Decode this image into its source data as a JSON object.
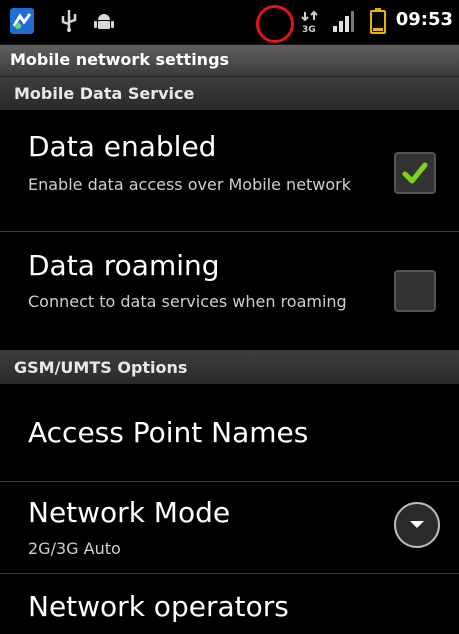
{
  "status_bar": {
    "time": "09:53",
    "network_type": "3G",
    "icons": [
      "sync-icon",
      "usb-icon",
      "android-debug-icon",
      "network-3g-icon",
      "signal-icon",
      "battery-icon"
    ]
  },
  "title_bar": {
    "title": "Mobile network settings"
  },
  "sections": {
    "mobile_data": {
      "label": "Mobile Data Service"
    },
    "gsm": {
      "label": "GSM/UMTS Options"
    }
  },
  "settings": {
    "data_enabled": {
      "title": "Data enabled",
      "summary": "Enable data access over Mobile network",
      "checked": true
    },
    "data_roaming": {
      "title": "Data roaming",
      "summary": "Connect to data services when roaming",
      "checked": false
    },
    "apn": {
      "title": "Access Point Names"
    },
    "network_mode": {
      "title": "Network Mode",
      "summary": "2G/3G Auto"
    },
    "network_operators": {
      "title": "Network operators"
    }
  },
  "colors": {
    "background": "#000000",
    "checkmark": "#7ed321",
    "annotation": "#e0151c"
  }
}
